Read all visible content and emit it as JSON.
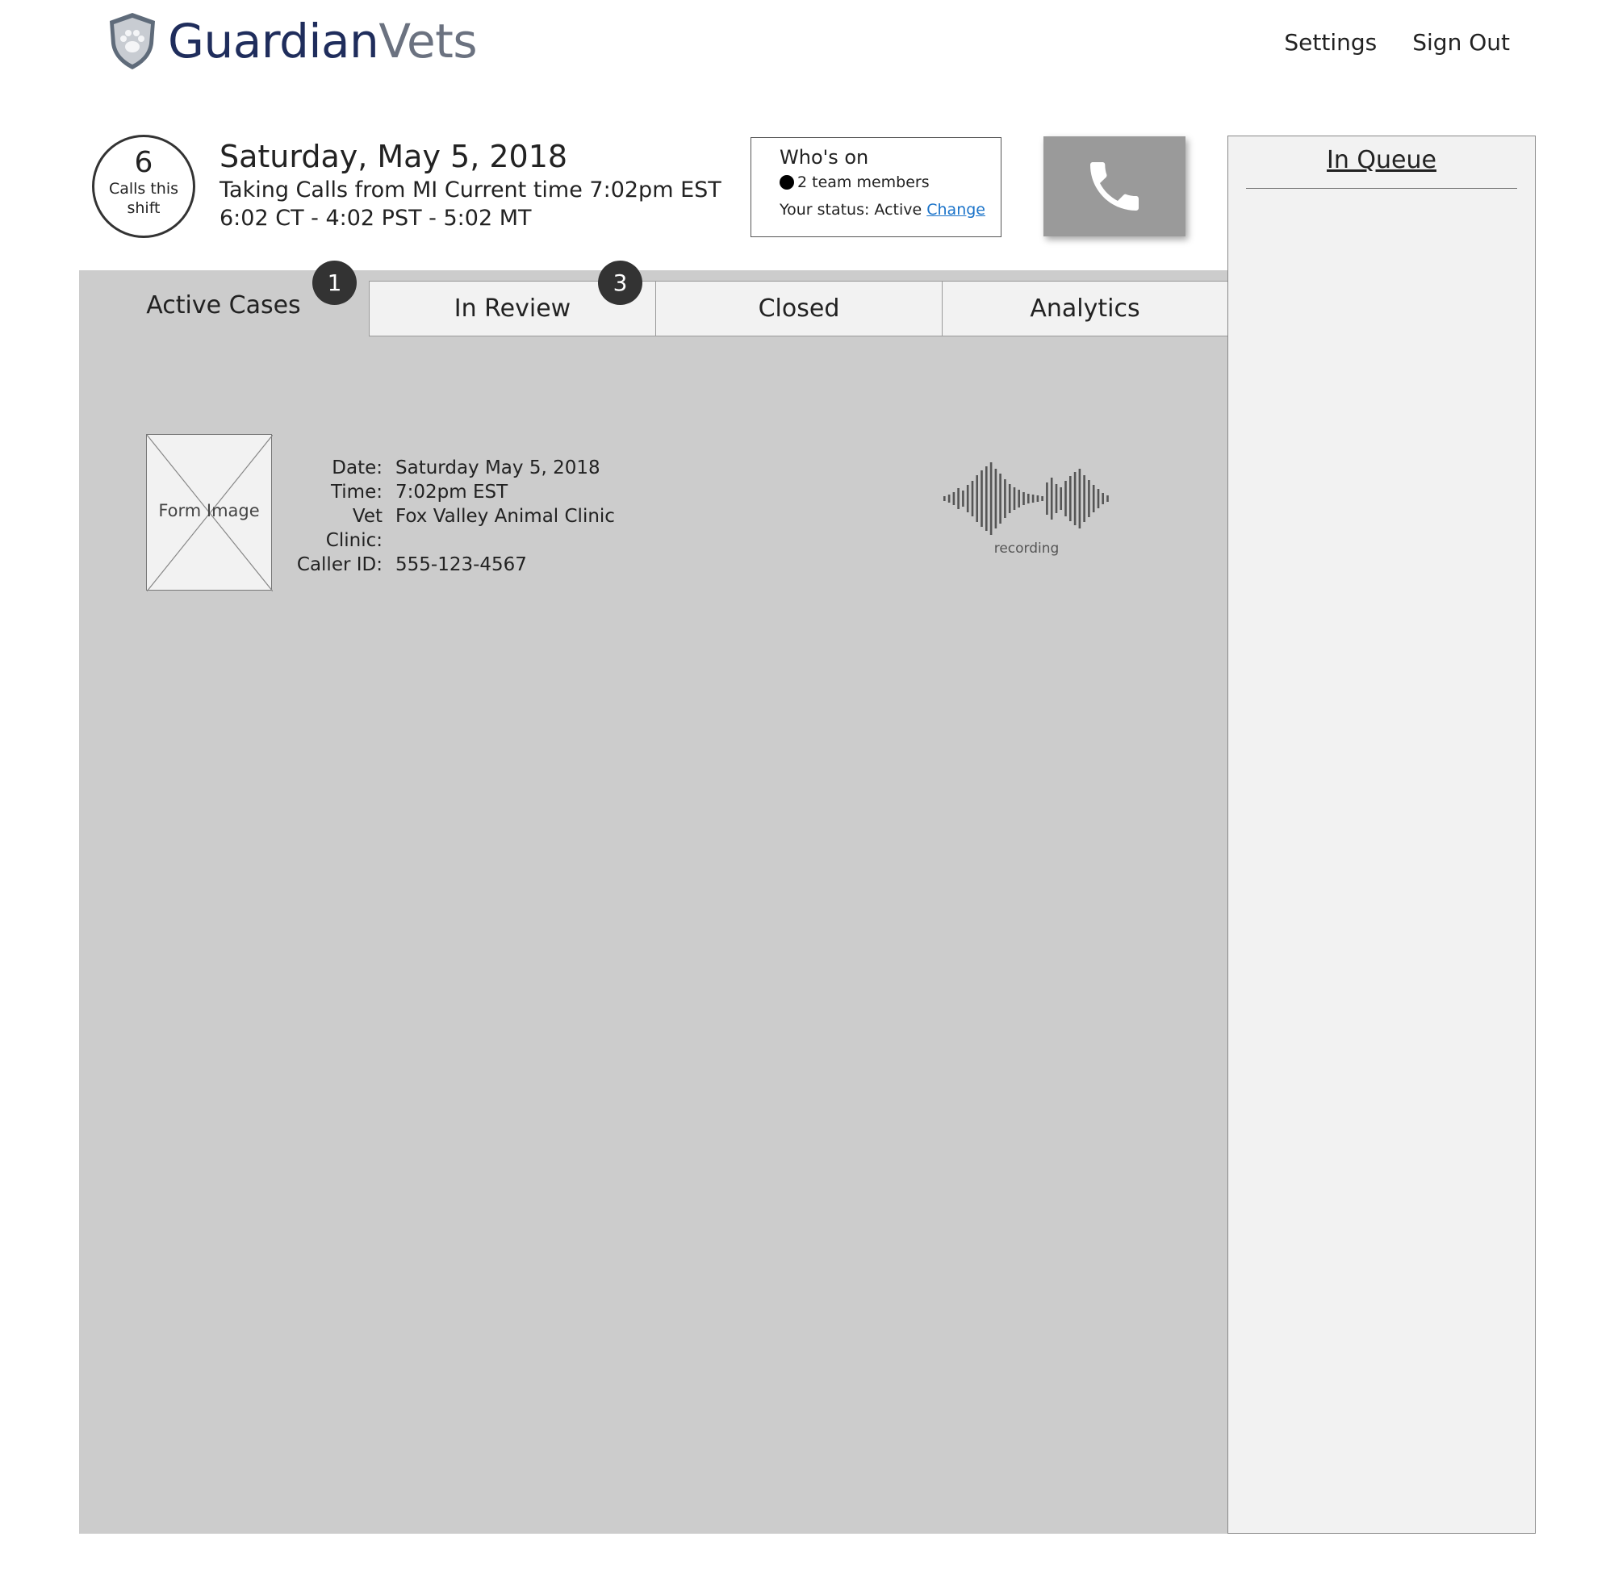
{
  "brand": {
    "name_part1": "Guardian",
    "name_part2": "Vets",
    "logo_icon": "paw-shield-icon"
  },
  "nav": {
    "settings": "Settings",
    "sign_out": "Sign Out"
  },
  "shift": {
    "calls_count": "6",
    "calls_label": "Calls this shift"
  },
  "header": {
    "date": "Saturday, May 5, 2018",
    "taking_calls": "Taking Calls from MI Current time 7:02pm EST",
    "timezones": "6:02 CT - 4:02 PST - 5:02 MT"
  },
  "whos_on": {
    "title": "Who's on",
    "members": "2 team members",
    "status_label": "Your status: Active",
    "change_link": "Change"
  },
  "call_button": {
    "icon": "phone-icon"
  },
  "tabs": [
    {
      "label": "Active Cases",
      "badge": "1",
      "active": true
    },
    {
      "label": "In Review",
      "badge": "3",
      "active": false
    },
    {
      "label": "Closed",
      "badge": "",
      "active": false
    },
    {
      "label": "Analytics",
      "badge": "",
      "active": false
    }
  ],
  "case": {
    "form_image_label": "Form Image",
    "fields": [
      {
        "label": "Date:",
        "value": "Saturday May 5, 2018"
      },
      {
        "label": "Time:",
        "value": "7:02pm EST"
      },
      {
        "label": "Vet Clinic:",
        "value": "Fox Valley Animal Clinic"
      },
      {
        "label": "Caller ID:",
        "value": "555-123-4567"
      }
    ],
    "recording_label": "recording"
  },
  "queue": {
    "title": "In Queue"
  },
  "colors": {
    "brand_navy": "#1f2d5c",
    "brand_gray": "#6b7280",
    "link": "#1a73c9",
    "panel": "#cccccc",
    "tab_bg": "#f2f2f2"
  }
}
